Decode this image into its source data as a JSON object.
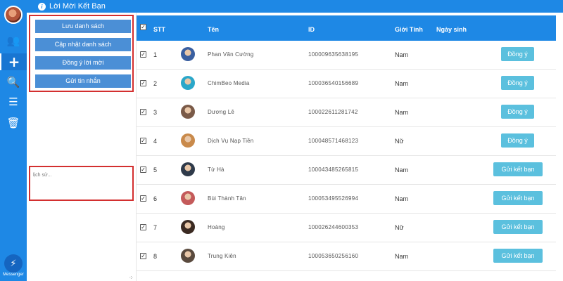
{
  "header": {
    "title": "Lời Mời Kết Bạn"
  },
  "sidebar": {
    "icons": [
      "users-icon",
      "plus-icon",
      "search-zoom-icon",
      "layers-icon",
      "trash-icon"
    ],
    "messenger_label": "Messenger"
  },
  "panel": {
    "buttons": [
      "Lưu danh sách",
      "Cập nhật danh sách",
      "Đồng ý lời mời",
      "Gửi tin nhắn"
    ],
    "history_placeholder": "lịch sử..."
  },
  "table": {
    "headers": {
      "stt": "STT",
      "name": "Tên",
      "id": "ID",
      "gender": "Giới Tính",
      "birthday": "Ngày sinh"
    },
    "rows": [
      {
        "stt": "1",
        "name": "Phan Văn Cường",
        "id": "100009635638195",
        "gender": "Nam",
        "action": "Đồng ý",
        "avatar_color": "#3a5fa0"
      },
      {
        "stt": "2",
        "name": "ChimBeo Media",
        "id": "100036540156689",
        "gender": "Nam",
        "action": "Đồng ý",
        "avatar_color": "#2aa7c9"
      },
      {
        "stt": "3",
        "name": "Dương Lê",
        "id": "100022611281742",
        "gender": "Nam",
        "action": "Đồng ý",
        "avatar_color": "#7a5a48"
      },
      {
        "stt": "4",
        "name": "Dịch Vụ Nạp Tiền",
        "id": "100048571468123",
        "gender": "Nữ",
        "action": "Đồng ý",
        "avatar_color": "#c98a4b"
      },
      {
        "stt": "5",
        "name": "Từ Hà",
        "id": "100043485265815",
        "gender": "Nam",
        "action": "Gửi kết bạn",
        "avatar_color": "#2f3a4a"
      },
      {
        "stt": "6",
        "name": "Bùi Thành Tân",
        "id": "100053495526994",
        "gender": "Nam",
        "action": "Gửi kết bạn",
        "avatar_color": "#c45a5a"
      },
      {
        "stt": "7",
        "name": "Hoàng",
        "id": "100026244600353",
        "gender": "Nữ",
        "action": "Gửi kết bạn",
        "avatar_color": "#3b2a22"
      },
      {
        "stt": "8",
        "name": "Trung Kiên",
        "id": "100053650256160",
        "gender": "Nam",
        "action": "Gửi kết bạn",
        "avatar_color": "#5a4a3e"
      }
    ]
  },
  "colors": {
    "primary": "#1e88e5",
    "button": "#4b8fd6",
    "action": "#5bc0de",
    "highlight": "#d32f2f"
  }
}
